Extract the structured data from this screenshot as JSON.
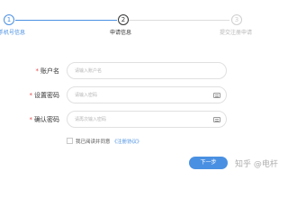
{
  "stepper": {
    "steps": [
      {
        "number": "1",
        "label": "手机号信息"
      },
      {
        "number": "2",
        "label": "申请信息"
      },
      {
        "number": "3",
        "label": "提交注册申请"
      }
    ]
  },
  "form": {
    "fields": [
      {
        "label": "账户名",
        "placeholder": "请输入账户名",
        "required": "*"
      },
      {
        "label": "设置密码",
        "placeholder": "请输入密码",
        "required": "*"
      },
      {
        "label": "确认密码",
        "placeholder": "请再次输入密码",
        "required": "*"
      }
    ],
    "agreement_text": "我已阅读并同意",
    "agreement_link": "《注册协议》"
  },
  "next_button_label": "下一步",
  "watermark": "知乎 @电杆",
  "colors": {
    "accent": "#4a90e2",
    "required": "#e54b4b"
  }
}
